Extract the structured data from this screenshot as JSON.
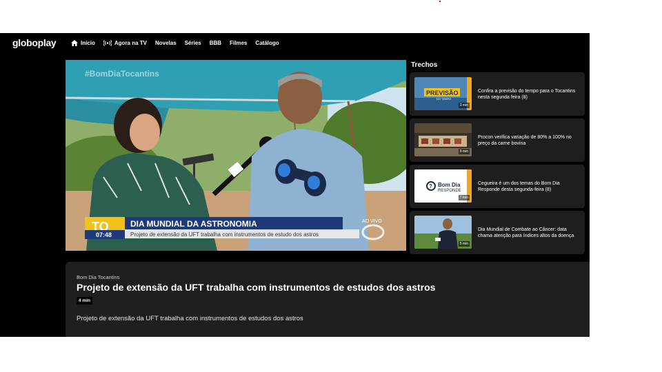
{
  "nav": {
    "logo": "globoplay",
    "items": [
      {
        "label": "Início",
        "icon": "home-icon"
      },
      {
        "label": "Agora na TV",
        "icon": "live-broadcast-icon"
      },
      {
        "label": "Novelas"
      },
      {
        "label": "Séries"
      },
      {
        "label": "BBB"
      },
      {
        "label": "Filmes"
      },
      {
        "label": "Catálogo"
      }
    ]
  },
  "player": {
    "hashtag": "#BomDiaTocantins",
    "station": "TO",
    "time": "07:48",
    "headline": "DIA MUNDIAL DA ASTRONOMIA",
    "subheadline": "Projeto de extensão da UFT trabalha com instrumentos de estudo dos astros",
    "live": "AO VIVO"
  },
  "trechos": {
    "title": "Trechos",
    "clips": [
      {
        "title": "Confira a previsão do tempo para o Tocantins nesta segunda feira (8)",
        "duration": "3 min",
        "thumb_text": "PREVISÃO",
        "thumb_sub": "DO TEMPO"
      },
      {
        "title": "Procon verifica variação de 80% a 100% no preço da carne bovina",
        "duration": "9 min"
      },
      {
        "title": "Cegueira é um dos temas do Bom Dia Responde desta segunda-feira (8)",
        "duration": "7 min",
        "thumb_text": "Bom Dia",
        "thumb_sub": "RESPONDE"
      },
      {
        "title": "Dia Mundial de Combate ao Câncer: data chama atenção para índices altos da doença",
        "duration": "5 min"
      }
    ]
  },
  "video": {
    "program": "Bom Dia Tocantins",
    "title": "Projeto de extensão da UFT trabalha com instrumentos de estudos dos astros",
    "duration": "4 min",
    "description": "Projeto de extensão da UFT trabalha com instrumentos de estudos dos astros"
  },
  "colors": {
    "background": "#000000",
    "card": "#1e1e1e",
    "panel": "#1f1f1f",
    "lower_third_blue": "#1e3a78",
    "accent_yellow": "#f2c21b"
  }
}
